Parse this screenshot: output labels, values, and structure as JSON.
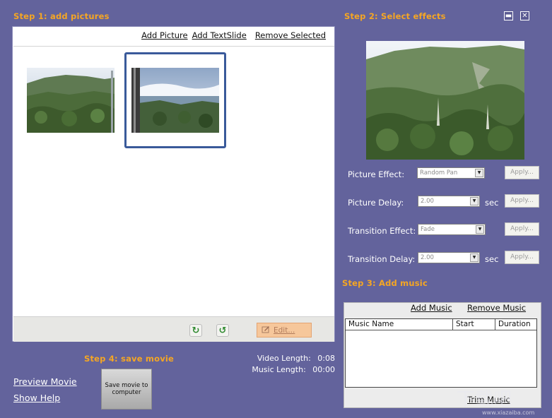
{
  "step1": {
    "title": "Step 1: add pictures",
    "add_picture": "Add Picture",
    "add_textslide": "Add TextSlide",
    "remove_selected": "Remove Selected",
    "edit_label": "Edit..."
  },
  "step2": {
    "title": "Step 2: Select effects",
    "rows": [
      {
        "label": "Picture Effect:",
        "value": "Random Pan",
        "unit": "",
        "apply": "Apply..."
      },
      {
        "label": "Picture Delay:",
        "value": "2.00",
        "unit": "sec",
        "apply": "Apply..."
      },
      {
        "label": "Transition Effect:",
        "value": "Fade",
        "unit": "",
        "apply": "Apply..."
      },
      {
        "label": "Transition Delay:",
        "value": "2.00",
        "unit": "sec",
        "apply": "Apply..."
      }
    ]
  },
  "step3": {
    "title": "Step 3: Add music",
    "add_music": "Add Music",
    "remove_music": "Remove Music",
    "columns": [
      "Music Name",
      "Start",
      "Duration"
    ],
    "trim_music": "Trim Music"
  },
  "step4": {
    "title": "Step 4: save movie",
    "save_button": "Save movie to computer",
    "preview_movie": "Preview Movie",
    "show_help": "Show Help",
    "video_length_label": "Video Length:",
    "video_length": "0:08",
    "music_length_label": "Music Length:",
    "music_length": "00:00"
  },
  "window": {
    "minimize_icon": "minimize-icon",
    "close_icon": "close-icon"
  },
  "watermark": {
    "site": "www.xiazaiba.com"
  },
  "colors": {
    "background": "#63639c",
    "accent": "#f5a623",
    "selection": "#3a5a9a"
  }
}
